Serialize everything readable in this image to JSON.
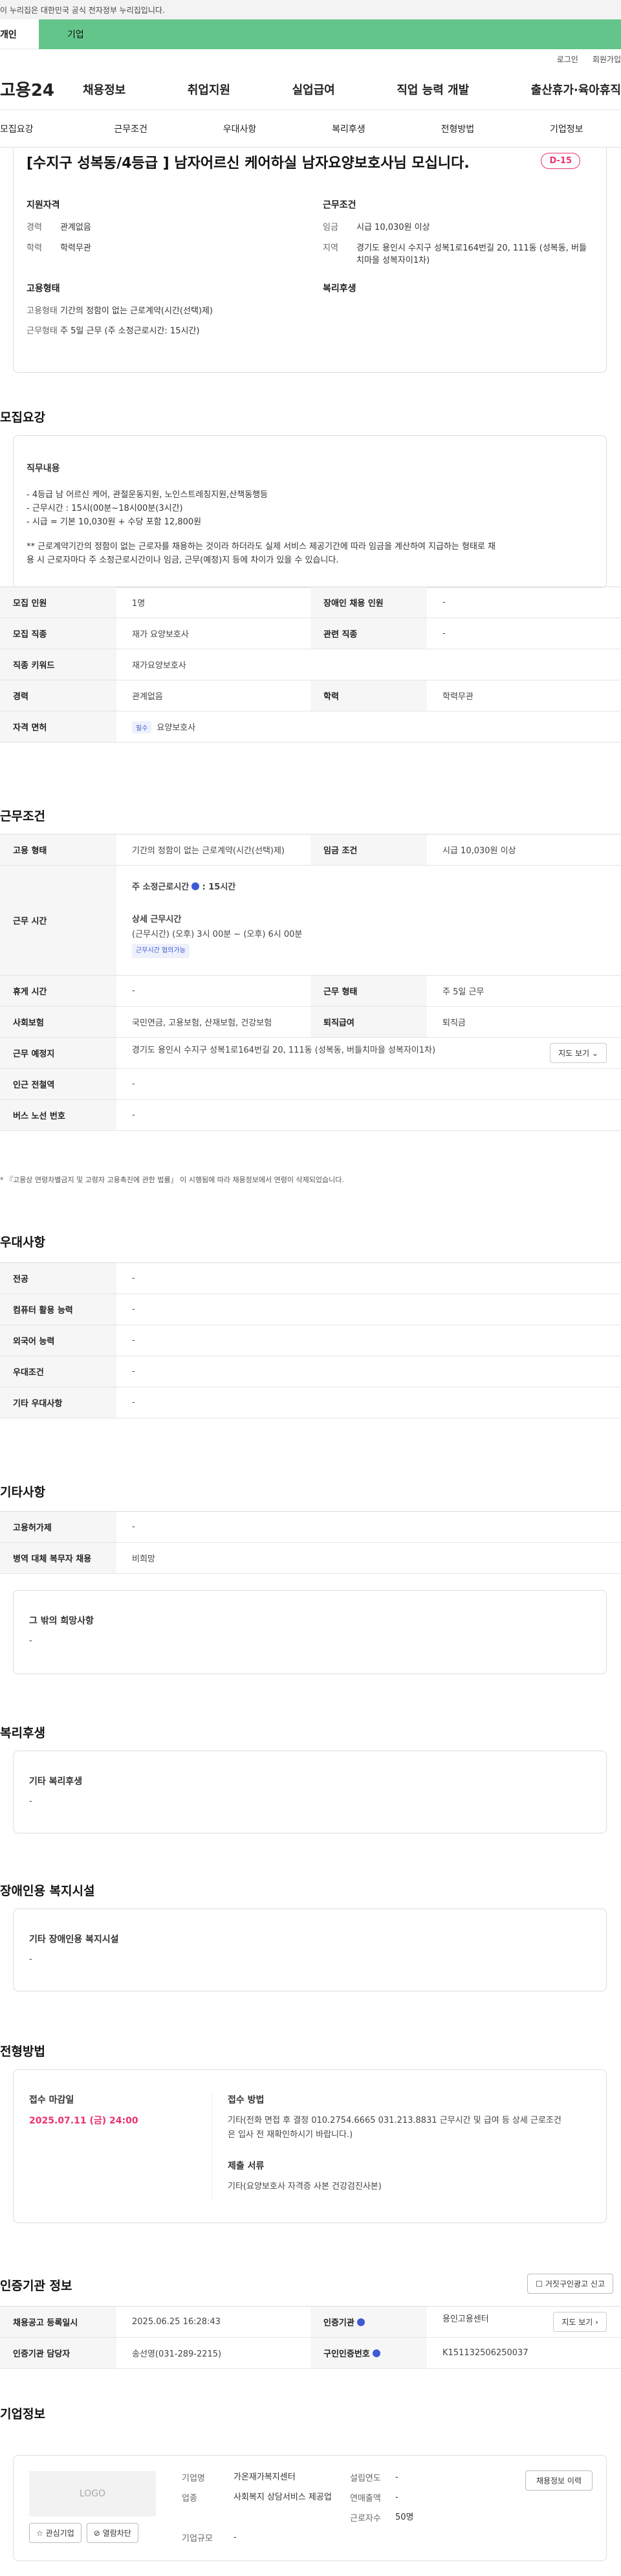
{
  "banner": {
    "text": "이 누리집은 대한민국 공식 전자정부 누리집입니다."
  },
  "top_tabs": {
    "personal": "개인",
    "company": "기업"
  },
  "util": {
    "login": "로그인",
    "join": "회원가입"
  },
  "gnb": {
    "logo": "고용24",
    "menu": [
      "채용정보",
      "취업지원",
      "실업급여",
      "직업 능력 개발",
      "출산휴가·육아휴직"
    ]
  },
  "section_tabs": [
    "모집요강",
    "근무조건",
    "우대사항",
    "복리후생",
    "전형방법",
    "기업정보"
  ],
  "summary": {
    "title": "[수지구 성복동/4등급 ] 남자어르신 케어하실 남자요양보호사님 모십니다.",
    "dday": "D-15",
    "qualifications": {
      "heading": "지원자격",
      "rows": [
        {
          "k": "경력",
          "v": "관계없음"
        },
        {
          "k": "학력",
          "v": "학력무관"
        }
      ]
    },
    "conditions": {
      "heading": "근무조건",
      "rows": [
        {
          "k": "임금",
          "v": "시급 10,030원 이상"
        },
        {
          "k": "지역",
          "v": "경기도 용인시 수지구 성복1로164번길 20, 111동 (성복동, 버들치마을 성복자이1차)"
        }
      ]
    },
    "employment": {
      "heading": "고용형태",
      "rows": [
        {
          "k": "고용형태",
          "v": "기간의 정함이 없는 근로계약(시간(선택)제)"
        },
        {
          "k": "근무형태",
          "v": "주 5일 근무 (주 소정근로시간: 15시간)"
        }
      ]
    },
    "welfare": {
      "heading": "복리후생"
    }
  },
  "recruit": {
    "title": "모집요강",
    "duty_heading": "직무내용",
    "duty_lines": [
      "- 4등급  남 어르신 케어, 관절운동지원, 노인스트레칭지원,산책동행등",
      "- 근무시간 : 15시(00분~18시00분(3시간)",
      "- 시급 = 기본 10,030원 + 수당 포함 12,800원"
    ],
    "duty_notes": [
      "** 근로계약기간의 정함이 없는 근로자를 채용하는 것이라 하더라도 실제 서비스 제공기간에 따라 임금을 계산하여 지급하는 형태로 채",
      "용 시 근로자마다 주 소정근로시간이나 임금, 근무(예정)지 등에 차이가 있을 수 있습니다."
    ],
    "rows": [
      {
        "k1": "모집 인원",
        "v1": "1명",
        "k2": "장애인 채용 인원",
        "v2": "-"
      },
      {
        "k1": "모집 직종",
        "v1": "재가 요양보호사",
        "k2": "관련 직종",
        "v2": "-"
      },
      {
        "k1": "직종 키워드",
        "v1": "재가요양보호사"
      },
      {
        "k1": "경력",
        "v1": "관계없음",
        "k2": "학력",
        "v2": "학력무관"
      },
      {
        "k1": "자격 면허",
        "tag": "필수",
        "v1": "요양보호사"
      }
    ]
  },
  "work": {
    "title": "근무조건",
    "employment_type": {
      "k": "고용 형태",
      "v": "기간의 정함이 없는 근로계약(시간(선택)제)",
      "k2": "임금 조건",
      "v2": "시급 10,030원 이상"
    },
    "hours": {
      "k": "근무 시간",
      "weekly_label": "주 소정근로시간",
      "weekly_value": ": 15시간",
      "detail_label": "상세 근무시간",
      "detail_value": "(근무시간) (오후) 3시 00분 ~ (오후) 6시 00분",
      "tag": "근무시간 협의가능"
    },
    "rows": [
      {
        "k1": "휴게 시간",
        "v1": "-",
        "k2": "근무 형태",
        "v2": "주 5일 근무"
      },
      {
        "k1": "사회보험",
        "v1": "국민연금, 고용보험, 산재보험, 건강보험",
        "k2": "퇴직급여",
        "v2": "퇴직금"
      }
    ],
    "location": {
      "k": "근무 예정지",
      "v": "경기도 용인시 수지구 성복1로164번길 20, 111동 (성복동, 버들치마을 성복자이1차)",
      "map": "지도 보기"
    },
    "station": {
      "k": "인근 전철역",
      "v": "-"
    },
    "bus": {
      "k": "버스 노선 번호",
      "v": "-"
    },
    "note": "* 『고용상 연령차별금지 및 고령자 고용촉진에 관한 법률』 이 시행됨에 따라 채용정보에서 연령이 삭제되었습니다."
  },
  "preference": {
    "title": "우대사항",
    "rows": [
      {
        "k": "전공",
        "v": "-"
      },
      {
        "k": "컴퓨터 활용 능력",
        "v": "-"
      },
      {
        "k": "외국어 능력",
        "v": "-"
      },
      {
        "k": "우대조건",
        "v": "-"
      },
      {
        "k": "기타 우대사항",
        "v": "-"
      }
    ]
  },
  "etc": {
    "title": "기타사항",
    "rows": [
      {
        "k": "고용허가제",
        "v": "-"
      },
      {
        "k": "병역 대체 복무자 채용",
        "v": "비희망"
      }
    ],
    "other_heading": "그 밖의 희망사항",
    "other_value": "-"
  },
  "welfare": {
    "title": "복리후생",
    "heading": "기타 복리후생",
    "value": "-"
  },
  "disability": {
    "title": "장애인용 복지시설",
    "heading": "기타 장애인용 복지시설",
    "value": "-"
  },
  "process": {
    "title": "전형방법",
    "deadline_label": "접수 마감일",
    "deadline": "2025.07.11 (금) 24:00",
    "method_label": "접수 방법",
    "method_lines": [
      "기타(전화 면접 후 결정 010.2754.6665 031.213.8831 근무시간 및 급여 등 상세 근로조건",
      "은 입사 전 재확인하시기 바랍니다.)"
    ],
    "docs_label": "제출 서류",
    "docs": "기타(요양보호사 자격증 사본 건강검진사본)"
  },
  "cert": {
    "title": "인증기관 정보",
    "fraud_btn": "거짓구인광고 신고",
    "rows": [
      {
        "k1": "채용공고 등록일시",
        "v1": "2025.06.25 16:28:43",
        "k2": "인증기관",
        "v2": "용인고용센터",
        "btn": "지도 보기"
      },
      {
        "k1": "인증기관 담당자",
        "v1": "송선영(031-289-2215)",
        "k2": "구인인증번호",
        "v2": "K151132506250037"
      }
    ]
  },
  "company": {
    "title": "기업정보",
    "logo": "LOGO",
    "fav_btn": "관심기업",
    "block_btn": "열람차단",
    "history_btn": "채용정보 이력",
    "info": [
      {
        "k": "기업명",
        "v": "가온재가복지센터",
        "k2": "설립연도",
        "v2": "-"
      },
      {
        "k": "업종",
        "v": "사회복지 상담서비스 제공업",
        "k2": "연매출액",
        "v2": "-"
      },
      {
        "k": "",
        "v": "",
        "k2": "근로자수",
        "v2": "50명"
      },
      {
        "k": "기업규모",
        "v": "-",
        "k2": "",
        "v2": ""
      }
    ]
  },
  "colors": {
    "accent_green": "#64c58a",
    "dday_pink": "#e8336e",
    "tag_blue": "#3e5bd5"
  }
}
